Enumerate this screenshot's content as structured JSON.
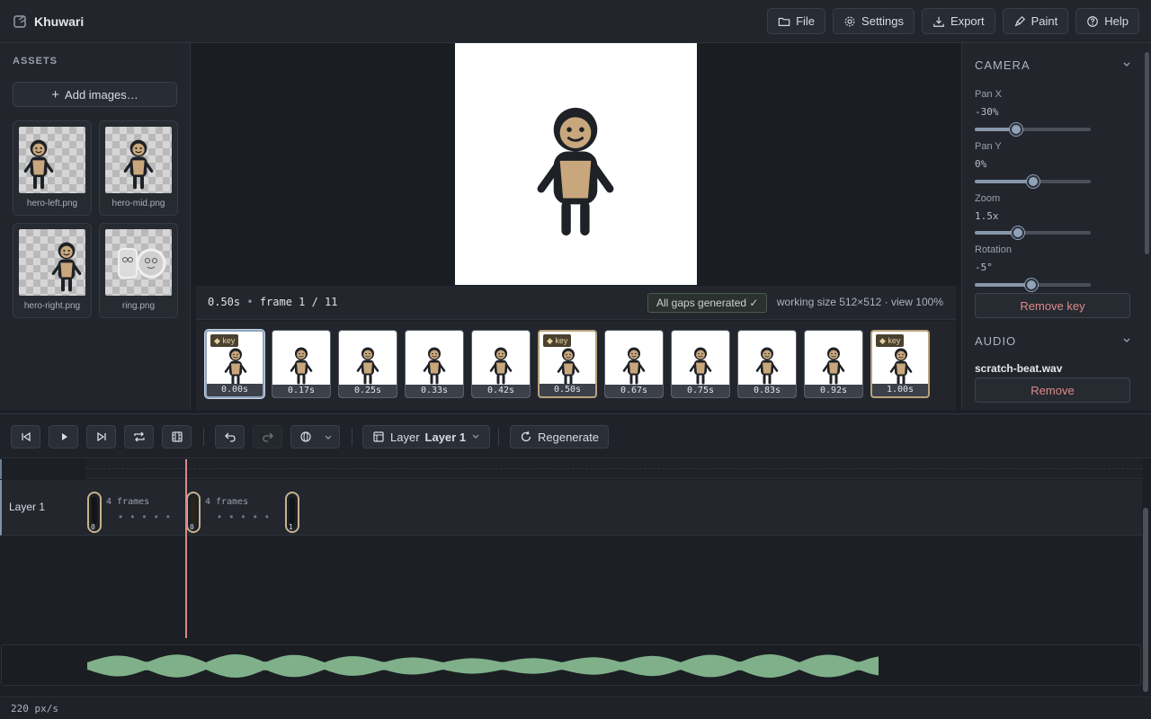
{
  "app": {
    "title": "Khuwari"
  },
  "header": {
    "buttons": [
      {
        "label": "File",
        "icon": "folder-icon"
      },
      {
        "label": "Settings",
        "icon": "gear-icon"
      },
      {
        "label": "Export",
        "icon": "download-icon"
      },
      {
        "label": "Paint",
        "icon": "brush-icon"
      },
      {
        "label": "Help",
        "icon": "help-icon"
      }
    ]
  },
  "sidebar": {
    "title": "ASSETS",
    "add_label": "Add images…",
    "assets": [
      {
        "name": "hero-left.png"
      },
      {
        "name": "hero-mid.png"
      },
      {
        "name": "hero-right.png"
      },
      {
        "name": "ring.png"
      }
    ]
  },
  "infobar": {
    "time": "0.50s",
    "frame": "frame 1 / 11",
    "gaps_badge": "All gaps generated ✓",
    "size": "working size 512×512 · view 100%"
  },
  "frames": [
    {
      "time": "0.00s",
      "key": true,
      "selected": true
    },
    {
      "time": "0.17s",
      "key": false
    },
    {
      "time": "0.25s",
      "key": false
    },
    {
      "time": "0.33s",
      "key": false
    },
    {
      "time": "0.42s",
      "key": false
    },
    {
      "time": "0.50s",
      "key": true
    },
    {
      "time": "0.67s",
      "key": false
    },
    {
      "time": "0.75s",
      "key": false
    },
    {
      "time": "0.83s",
      "key": false
    },
    {
      "time": "0.92s",
      "key": false
    },
    {
      "time": "1.00s",
      "key": true
    }
  ],
  "key_badge": "◆ key",
  "camera": {
    "title": "CAMERA",
    "pan_x": {
      "label": "Pan X",
      "value": "-30%",
      "level": 0.36
    },
    "pan_y": {
      "label": "Pan Y",
      "value": "0%",
      "level": 0.5
    },
    "zoom": {
      "label": "Zoom",
      "value": "1.5x",
      "level": 0.37
    },
    "rotation": {
      "label": "Rotation",
      "value": "-5°",
      "level": 0.49
    },
    "remove_key": "Remove key"
  },
  "audio_panel": {
    "title": "AUDIO",
    "file": "scratch-beat.wav",
    "remove": "Remove"
  },
  "toolbar": {
    "layer_prefix": "Layer",
    "layer_name": "Layer 1",
    "regenerate": "Regenerate"
  },
  "timeline": {
    "track_name": "Layer 1",
    "keyframes": [
      "0",
      "0",
      "1"
    ],
    "gaps": [
      "4 frames",
      "4 frames"
    ]
  },
  "footer": {
    "scale": "220 px/s"
  },
  "colors": {
    "accent": "#8fa2b8",
    "key": "#c5b28e",
    "playhead": "#d88a8a",
    "waveform": "#7fb08a",
    "danger": "#e08a8a"
  }
}
